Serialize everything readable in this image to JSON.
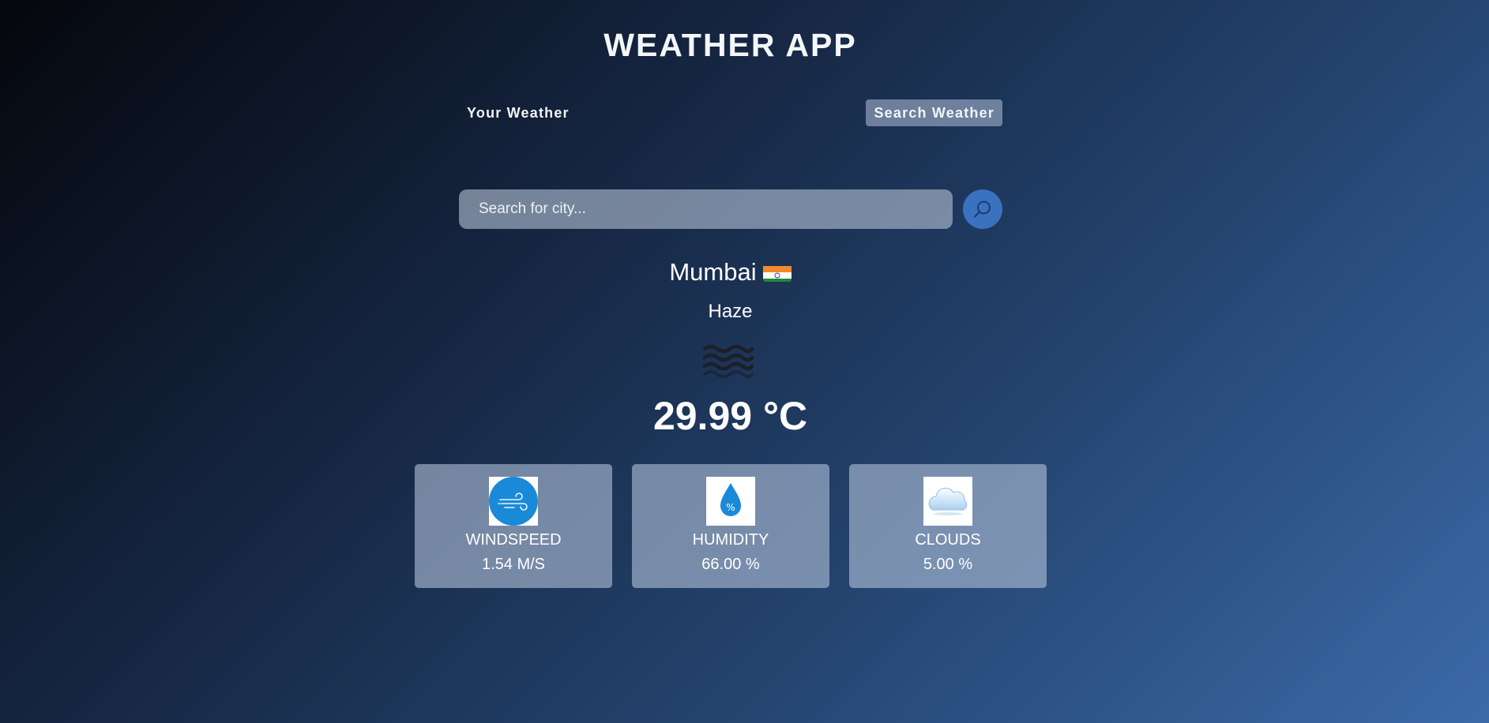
{
  "app": {
    "title": "WEATHER APP"
  },
  "tabs": [
    {
      "label": "Your Weather"
    },
    {
      "label": "Search Weather"
    }
  ],
  "search": {
    "placeholder": "Search for city...",
    "button_icon": "search-icon"
  },
  "weather": {
    "city": "Mumbai",
    "country_flag": "india-flag-icon",
    "condition": "Haze",
    "condition_icon": "haze-icon",
    "temperature": "29.99 °C"
  },
  "stats": [
    {
      "label": "WINDSPEED",
      "value": "1.54 M/S",
      "icon": "wind-icon"
    },
    {
      "label": "HUMIDITY",
      "value": "66.00 %",
      "icon": "humidity-icon"
    },
    {
      "label": "CLOUDS",
      "value": "5.00 %",
      "icon": "cloud-icon"
    }
  ],
  "colors": {
    "accent": "#3a72c0",
    "stat_icon_blue": "#1a8ad8"
  }
}
